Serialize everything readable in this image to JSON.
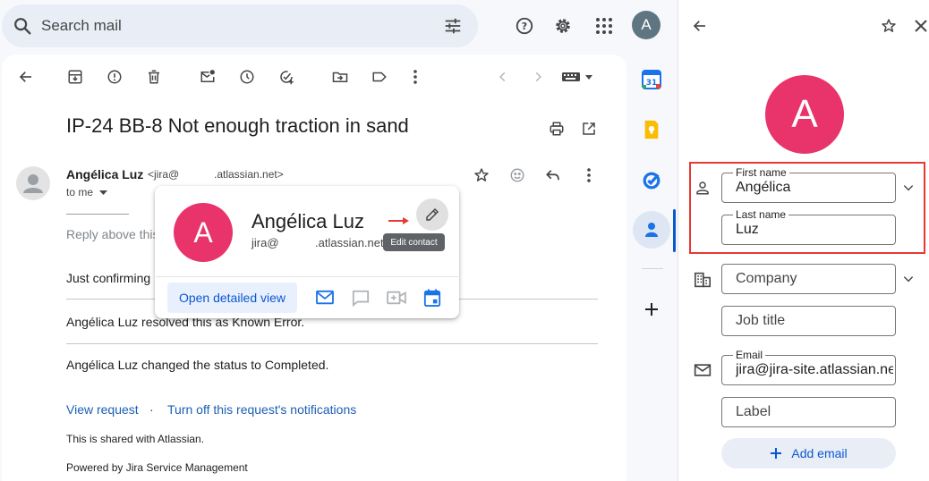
{
  "search": {
    "placeholder": "Search mail"
  },
  "account": {
    "initial": "A",
    "color": "#5f7582"
  },
  "email": {
    "subject": "IP-24 BB-8 Not enough traction in sand",
    "sender_name": "Angélica Luz",
    "sender_email_prefix": "<jira@",
    "sender_email_suffix": ".atlassian.net>",
    "to_label": "to me",
    "separator": "__________",
    "reply_above": "Reply above this",
    "line1": "Just confirming",
    "line2": "Angélica Luz resolved this as Known Error.",
    "line3": "Angélica Luz changed the status to Completed.",
    "view_request": "View request",
    "dot": "·",
    "turn_off": "Turn off this request's notifications",
    "shared": "This is shared with Atlassian.",
    "powered": "Powered by Jira Service Management"
  },
  "hover_card": {
    "initial": "A",
    "name": "Angélica Luz",
    "email_prefix": "jira@",
    "email_suffix": ".atlassian.net",
    "tooltip": "Edit contact",
    "open_detailed": "Open detailed view"
  },
  "contact_panel": {
    "initial": "A",
    "avatar_color": "#e8336b",
    "first_name_label": "First name",
    "first_name_value": "Angélica",
    "last_name_label": "Last name",
    "last_name_value": "Luz",
    "company_placeholder": "Company",
    "job_title_placeholder": "Job title",
    "email_label": "Email",
    "email_value": "jira@jira-site.atlassian.net",
    "label_placeholder": "Label",
    "add_email": "Add email"
  },
  "colors": {
    "accent": "#0b57d0",
    "highlight": "#e53935"
  }
}
